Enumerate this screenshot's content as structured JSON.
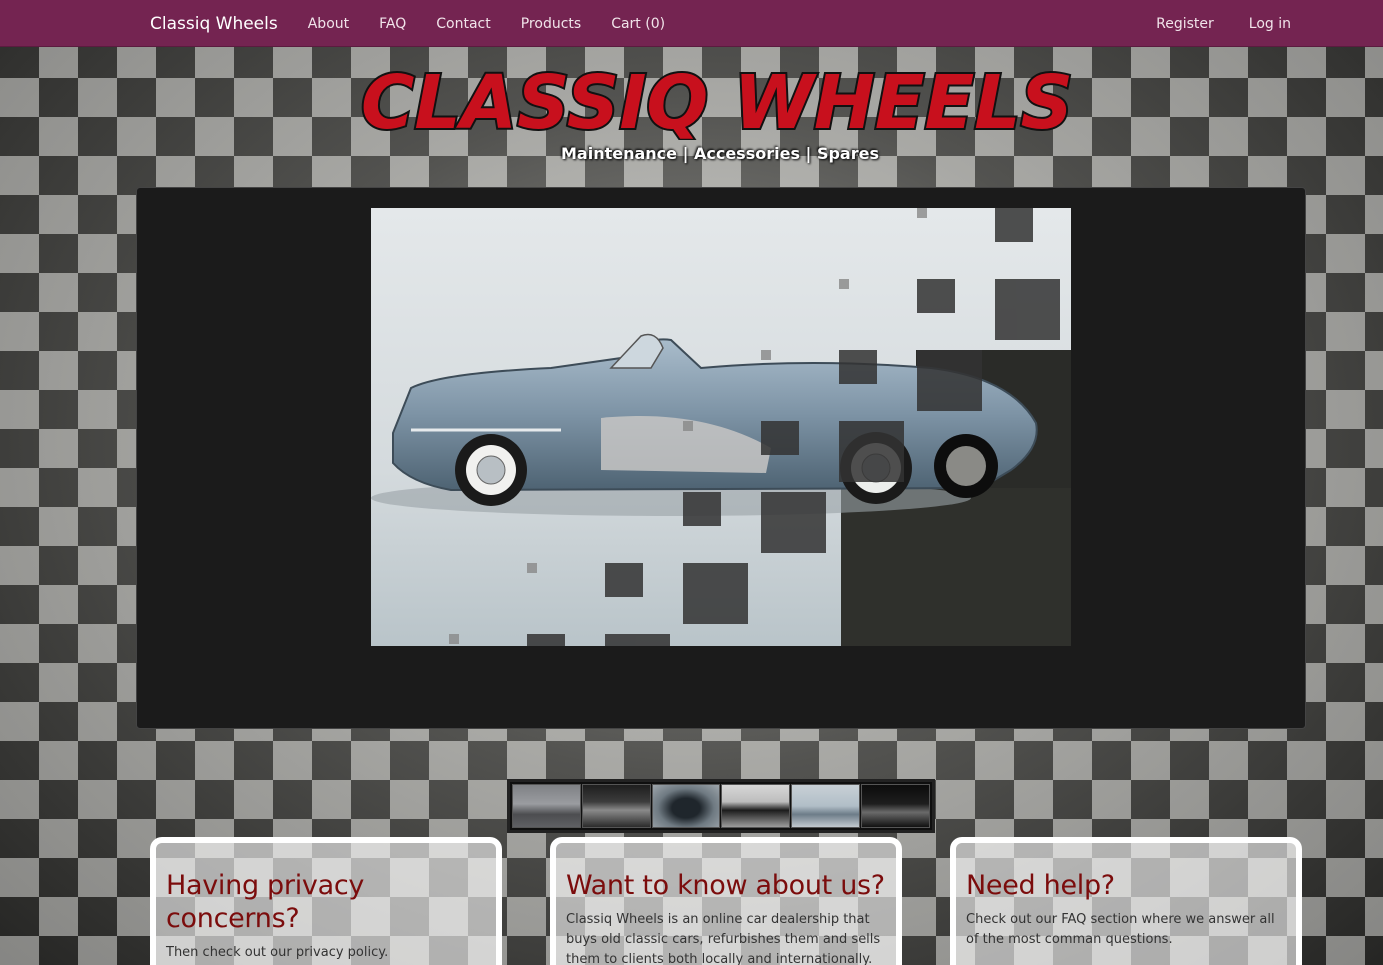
{
  "navbar": {
    "brand": "Classiq Wheels",
    "links": [
      "About",
      "FAQ",
      "Contact",
      "Products",
      "Cart (0)"
    ],
    "right_links": [
      "Register",
      "Log in"
    ]
  },
  "header": {
    "logo_text": "CLASSIQ WHEELS",
    "tagline": "Maintenance | Accessories | Spares"
  },
  "carousel": {
    "slide_alt": "Classic convertible car transitioning to Jaguar E-Type",
    "thumbnails": [
      "thumb-1",
      "thumb-2",
      "thumb-3",
      "thumb-4",
      "thumb-5",
      "thumb-6"
    ]
  },
  "info_boxes": [
    {
      "title": "Having privacy concerns?",
      "text": "Then check out our privacy policy."
    },
    {
      "title": "Want to know about us?",
      "text": "Classiq Wheels is an online car dealership that buys old classic cars, refurbishes them and sells them to clients both locally and internationally."
    },
    {
      "title": "Need help?",
      "text": "Check out our FAQ section where we answer all of the most comman questions."
    }
  ],
  "colors": {
    "navbar": "#742451",
    "heading": "#7b0c0c",
    "logo_red": "#c8101d"
  }
}
